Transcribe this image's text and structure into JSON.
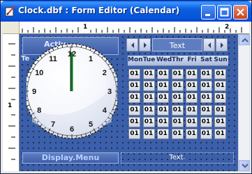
{
  "window": {
    "title": "Clock.dbf : Form Editor (Calendar)",
    "icons": {
      "app": "form-editor-pencil-icon",
      "minimize": "minimize-icon",
      "maximize": "maximize-icon",
      "close": "close-icon"
    }
  },
  "rulers": {
    "horizontal_labels": [
      "1",
      "2"
    ],
    "vertical_labels": [
      "1"
    ]
  },
  "form": {
    "activex_label": "Activ",
    "text_label": "Te",
    "clock_hours": [
      "12",
      "1",
      "2",
      "3",
      "4",
      "5",
      "6",
      "7",
      "8",
      "9",
      "10",
      "11"
    ],
    "calendar": {
      "header_text": "Text",
      "days": [
        "Mon",
        "Tue",
        "Wed",
        "Thr",
        "Fri",
        "Sat",
        "Sun"
      ],
      "cell_value": "01",
      "rows": 6,
      "cols": 7
    },
    "menu_label": "Display.Menu",
    "text_bar": "Text."
  },
  "colors": {
    "titlebar": "#0553d8",
    "canvas": "#3b5fa8",
    "close_button": "#c9431f"
  }
}
